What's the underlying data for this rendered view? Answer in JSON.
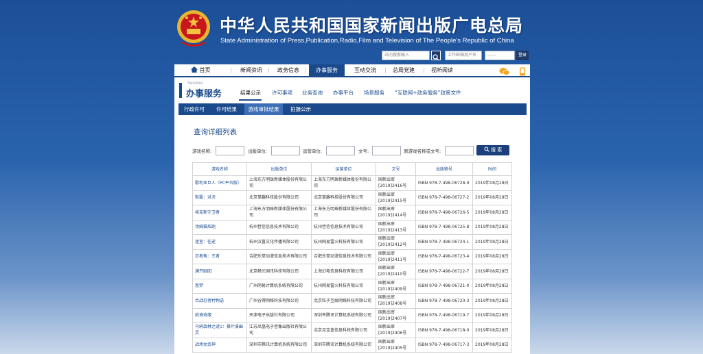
{
  "header": {
    "title_cn": "中华人民共和国国家新闻出版广电总局",
    "title_en": "State Administration of Press,Publication,Radio,Film and Television of The People's Republic of China",
    "site_search_placeholder": "站内搜索输入",
    "mail_placeholder": "工作邮箱用户名",
    "pwd_placeholder": "——",
    "login_label": "登录"
  },
  "nav": {
    "items": [
      "首页",
      "新闻资讯",
      "政务信息",
      "办事服务",
      "互动交流",
      "总局党建",
      "视听阅读"
    ]
  },
  "services": {
    "en": "Services",
    "title": "办事服务",
    "tabs": [
      "结果公示",
      "许可事项",
      "业务查询",
      "办事平台",
      "场景服务",
      "“互联网+政务服务”政策文件"
    ]
  },
  "subnav": {
    "items": [
      "行政许可",
      "许可结果",
      "游戏审批结果",
      "拍摄公示"
    ]
  },
  "list": {
    "title": "查询详细列表"
  },
  "filters": {
    "game_name": "游戏名称:",
    "publisher": "出版单位:",
    "operator": "运营单位:",
    "doc_no": "文号:",
    "original_name": "原游戏名称或文号:",
    "search_button": "搜 索"
  },
  "table": {
    "headers": [
      "游戏名称",
      "出版单位",
      "运营单位",
      "文号",
      "出版物号",
      "时间"
    ],
    "rows": [
      [
        "歌利亚巨人（PC平台版）",
        "上海东方明珠新媒体股份有限公司",
        "上海东方明珠新媒体股份有限公司",
        "国新出审[2019]2416号",
        "ISBN 978-7-498-06728-9",
        "2019年08月28日"
      ],
      [
        "街霸：对决",
        "北京掌趣科技股份有限公司",
        "北京掌趣科技股份有限公司",
        "国新出审[2019]2415号",
        "ISBN 978-7-498-06727-2",
        "2019年08月28日"
      ],
      [
        "埃克斯守卫者",
        "上海东方明珠新媒体股份有限公司",
        "上海东方明珠新媒体股份有限公司",
        "国新出审[2019]2414号",
        "ISBN 978-7-498-06726-5",
        "2019年08月28日"
      ],
      [
        "汤姆猫炫跑",
        "杭州哲信信息技术有限公司",
        "杭州哲信信息技术有限公司",
        "国新出审[2019]2413号",
        "ISBN 978-7-498-06725-8",
        "2019年08月28日"
      ],
      [
        "迷室：往逝",
        "杭州汉喜文化传播有限公司",
        "杭州网易雷火科技有限公司",
        "国新出审[2019]2412号",
        "ISBN 978-7-498-06724-1",
        "2019年08月28日"
      ],
      [
        "忍者龟：王者",
        "合肥乐堂动漫信息技术有限公司",
        "合肥乐堂动漫信息技术有限公司",
        "国新出审[2019]2411号",
        "ISBN 978-7-498-06723-4",
        "2019年08月28日"
      ],
      [
        "满开剧团",
        "北京畅元国讯科技有限公司",
        "上海幻电信息科技有限公司",
        "国新出审[2019]2410号",
        "ISBN 978-7-498-06722-7",
        "2019年08月28日"
      ],
      [
        "悠梦",
        "广州网易计算机系统有限公司",
        "杭州网易雷火科技有限公司",
        "国新出审[2019]2409号",
        "ISBN 978-7-498-06721-0",
        "2019年08月28日"
      ],
      [
        "合战忍者村物语",
        "广州谷得网络科技有限公司",
        "北京粒子互娱网络科技有限公司",
        "国新出审[2019]2408号",
        "ISBN 978-7-498-06720-3",
        "2019年08月28日"
      ],
      [
        "纸境奇缘",
        "天津电子出版社有限公司",
        "深圳市腾讯计算机系统有限公司",
        "国新出审[2019]2407号",
        "ISBN 978-7-498-06719-7",
        "2019年08月28日"
      ],
      [
        "乌鸦森林之谜1：枫叶溪幽灵",
        "江苏凤凰电子音像出版社有限公司",
        "北京月宝盒信息科技有限公司",
        "国新出审[2019]2406号",
        "ISBN 978-7-498-06718-0",
        "2019年08月28日"
      ],
      [
        "战场女武神",
        "深圳市腾讯计算机系统有限公司",
        "深圳市腾讯计算机系统有限公司",
        "国新出审[2019]2405号",
        "ISBN 978-7-498-06717-3",
        "2019年08月28日"
      ]
    ]
  },
  "colors": {
    "primary": "#1a4a8c",
    "background_top": "#1b4f98",
    "emblem_red": "#c8161d",
    "emblem_gold": "#f5c242"
  }
}
